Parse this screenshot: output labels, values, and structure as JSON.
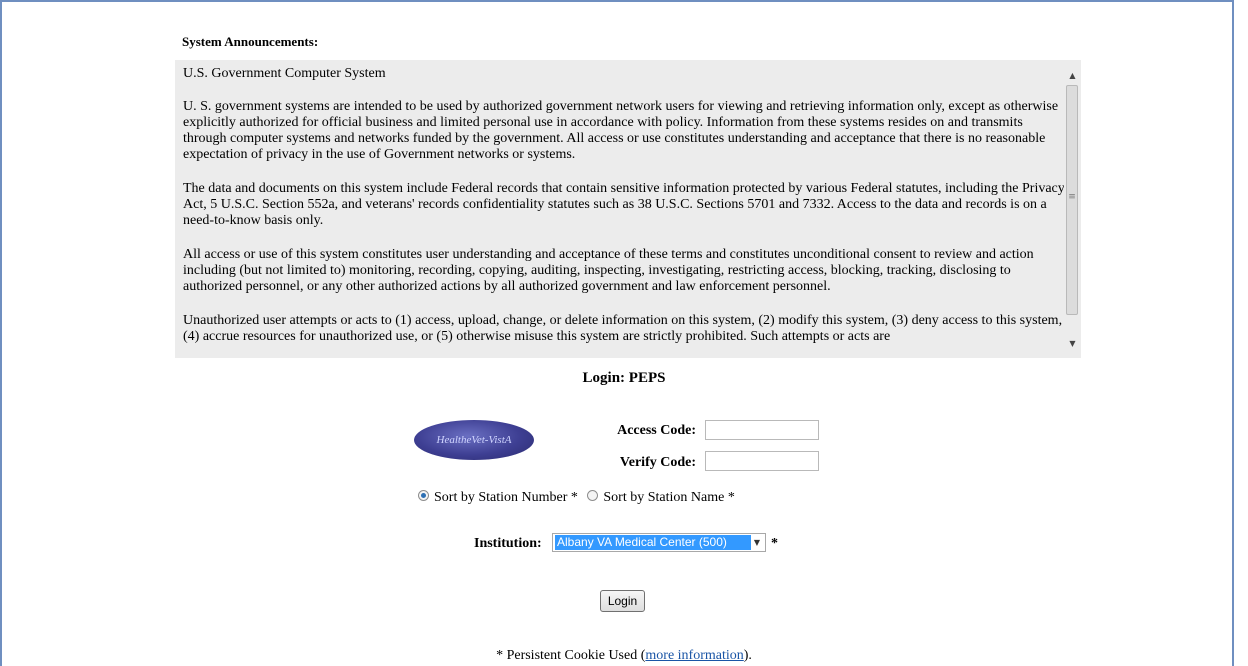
{
  "announcements": {
    "heading": "System Announcements:",
    "paragraphs": [
      "U.S. Government Computer System",
      "U. S. government systems are intended to be used by authorized government network users for viewing and retrieving information only, except as otherwise explicitly authorized for official business and limited personal use in accordance with policy. Information from these systems resides on and transmits through computer systems and networks funded by the government. All access or use constitutes understanding and acceptance that there is no reasonable expectation of privacy in the use of Government networks or systems.",
      "The data and documents on this system include Federal records that contain sensitive information protected by various Federal statutes, including the Privacy Act, 5 U.S.C. Section 552a, and veterans' records confidentiality statutes such as 38 U.S.C. Sections 5701 and 7332. Access to the data and records is on a need-to-know basis only.",
      "All access or use of this system constitutes user understanding and acceptance of these terms and constitutes unconditional consent to review and action including (but not limited to) monitoring, recording, copying, auditing, inspecting, investigating, restricting access, blocking, tracking, disclosing to authorized personnel, or any other authorized actions by all authorized government and law enforcement personnel.",
      "Unauthorized user attempts or acts to (1) access, upload, change, or delete information on this system, (2) modify this system, (3) deny access to this system, (4) accrue resources for unauthorized use, or (5) otherwise misuse this system are strictly prohibited. Such attempts or acts are"
    ]
  },
  "login": {
    "title": "Login: PEPS",
    "logo_text": "HealtheVet-VistA",
    "access_code_label": "Access Code:",
    "access_code_value": "",
    "verify_code_label": "Verify Code:",
    "verify_code_value": "",
    "sort_options": [
      {
        "label": "Sort by Station Number *",
        "selected": true
      },
      {
        "label": "Sort by Station Name *",
        "selected": false
      }
    ],
    "institution_label": "Institution:",
    "institution_value": "Albany VA Medical Center (500)",
    "required_marker": "*",
    "login_button": "Login",
    "cookie_prefix": "* Persistent Cookie Used (",
    "cookie_link": "more information",
    "cookie_suffix": ")."
  },
  "colors": {
    "frame_border": "#6f8fc0",
    "announcement_bg": "#ececec",
    "selection_bg": "#3399ff",
    "link": "#1a55a6"
  }
}
